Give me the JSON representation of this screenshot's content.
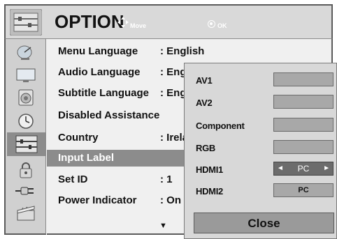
{
  "header": {
    "title": "OPTION",
    "hint_move": "Move",
    "hint_ok": "OK",
    "icon": "option-menu-icon"
  },
  "sidebar": {
    "items": [
      {
        "icon": "satellite-dish-icon"
      },
      {
        "icon": "monitor-icon"
      },
      {
        "icon": "speaker-icon"
      },
      {
        "icon": "clock-icon"
      },
      {
        "icon": "option-menu-icon",
        "selected": true
      },
      {
        "icon": "lock-icon"
      },
      {
        "icon": "cable-plug-icon"
      },
      {
        "icon": "media-slate-icon"
      }
    ]
  },
  "menu": {
    "rows": [
      {
        "label": "Menu Language",
        "value": ": English"
      },
      {
        "label": "Audio Language",
        "value": ": Eng"
      },
      {
        "label": "Subtitle Language",
        "value": ": Eng"
      },
      {
        "label": "Disabled Assistance",
        "value": ""
      },
      {
        "label": "Country",
        "value": ": Irela"
      },
      {
        "label": "Input Label",
        "value": "",
        "highlighted": true
      },
      {
        "label": "Set ID",
        "value": ": 1"
      },
      {
        "label": "Power Indicator",
        "value": ": On"
      }
    ],
    "more_arrow": "▼"
  },
  "popup": {
    "rows": [
      {
        "label": "AV1",
        "value": ""
      },
      {
        "label": "AV2",
        "value": ""
      },
      {
        "label": "Component",
        "value": ""
      },
      {
        "label": "RGB",
        "value": ""
      },
      {
        "label": "HDMI1",
        "value": "PC",
        "selected": true,
        "left_arrow": "◄",
        "right_arrow": "►"
      },
      {
        "label": "HDMI2",
        "value": "PC"
      }
    ],
    "close_label": "Close"
  }
}
